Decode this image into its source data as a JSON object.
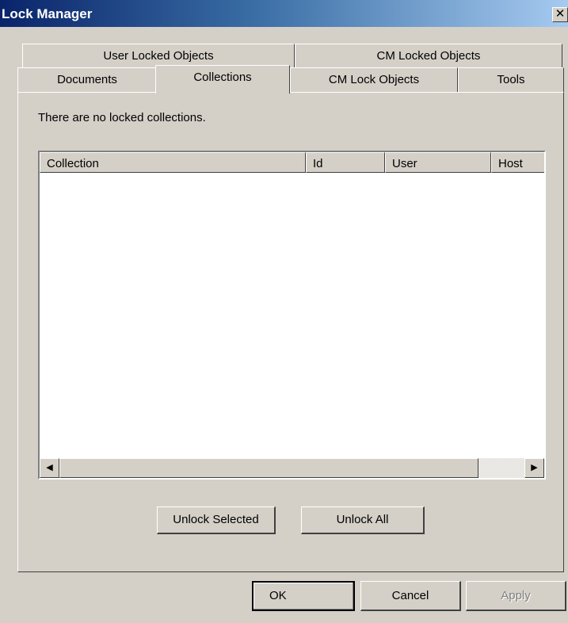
{
  "window": {
    "title": "Lock Manager",
    "close_glyph": "✕"
  },
  "tabs_back": [
    {
      "label": "User Locked Objects"
    },
    {
      "label": "CM Locked Objects"
    }
  ],
  "tabs_front": [
    {
      "label": "Documents"
    },
    {
      "label": "Collections",
      "selected": true
    },
    {
      "label": "CM Lock Objects"
    },
    {
      "label": "Tools"
    }
  ],
  "panel": {
    "message": "There are no locked collections.",
    "columns": [
      "Collection",
      "Id",
      "User",
      "Host"
    ],
    "rows": [],
    "scroll_left": "◀",
    "scroll_right": "▶"
  },
  "actions": {
    "unlock_selected": "Unlock Selected",
    "unlock_all": "Unlock All"
  },
  "footer": {
    "ok": "OK",
    "cancel": "Cancel",
    "apply": "Apply"
  },
  "colors": {
    "face": "#d4d0c8",
    "title_start": "#0a246a",
    "title_end": "#a6caf0"
  }
}
